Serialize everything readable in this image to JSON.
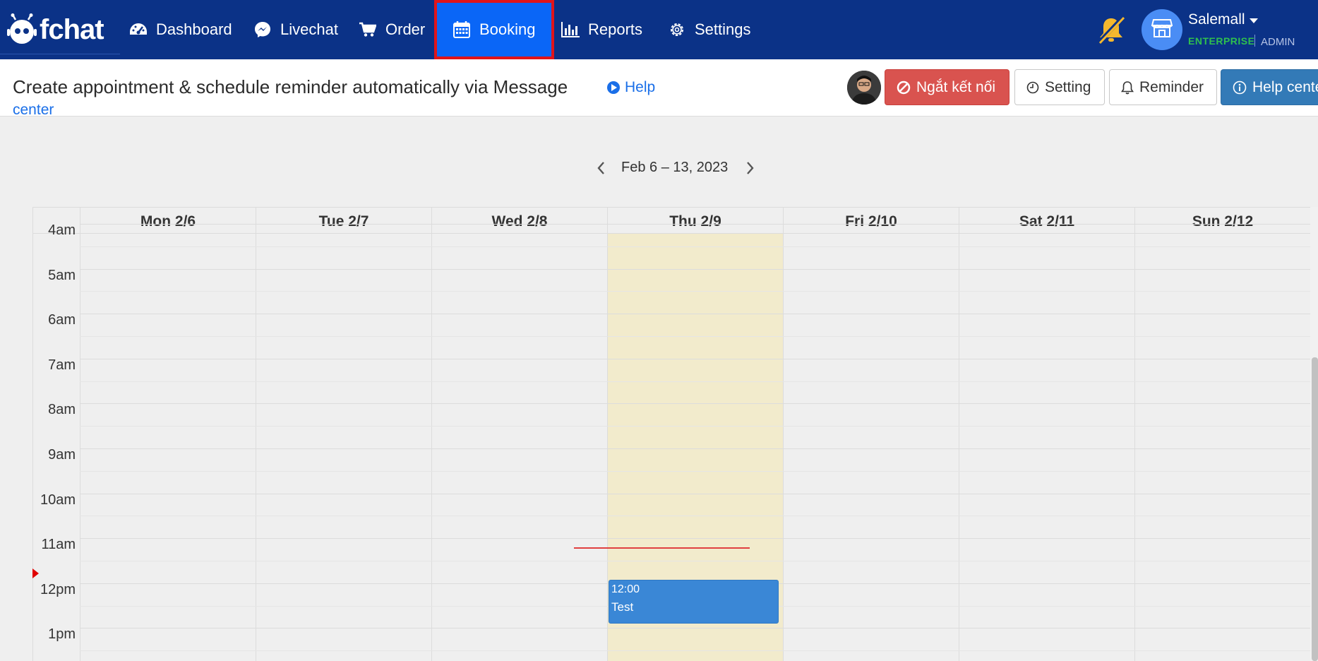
{
  "brand": {
    "name": "fchat"
  },
  "nav": {
    "items": [
      {
        "label": "Dashboard",
        "icon": "gauge-icon"
      },
      {
        "label": "Livechat",
        "icon": "messenger-icon"
      },
      {
        "label": "Order",
        "icon": "cart-icon"
      },
      {
        "label": "Booking",
        "icon": "calendar-icon",
        "active": true
      },
      {
        "label": "Reports",
        "icon": "bar-chart-icon"
      },
      {
        "label": "Settings",
        "icon": "gear-icon"
      }
    ]
  },
  "user": {
    "name": "Salemall",
    "plan": "ENTERPRISE",
    "role": "ADMIN"
  },
  "header": {
    "title": "Create appointment & schedule reminder automatically via Message",
    "help_label": "Help",
    "help_label_2": "center"
  },
  "actions": {
    "disconnect": "Ngắt kết nối",
    "setting": "Setting",
    "reminder": "Reminder",
    "help_center": "Help center"
  },
  "calendar": {
    "range": "Feb 6 – 13, 2023",
    "days": [
      "Mon 2/6",
      "Tue 2/7",
      "Wed 2/8",
      "Thu 2/9",
      "Fri 2/10",
      "Sat 2/11",
      "Sun 2/12"
    ],
    "today_index": 3,
    "times": [
      "4am",
      "5am",
      "6am",
      "7am",
      "8am",
      "9am",
      "10am",
      "11am",
      "12pm",
      "1pm"
    ],
    "event": {
      "time": "12:00",
      "title": "Test"
    }
  },
  "colors": {
    "navbar": "#0b3287",
    "active_tab": "#0a66f7",
    "highlight_border": "#e0141a",
    "today": "#f2ebcc",
    "event": "#3a87d6",
    "danger": "#d9534f",
    "primary": "#337ab7"
  }
}
